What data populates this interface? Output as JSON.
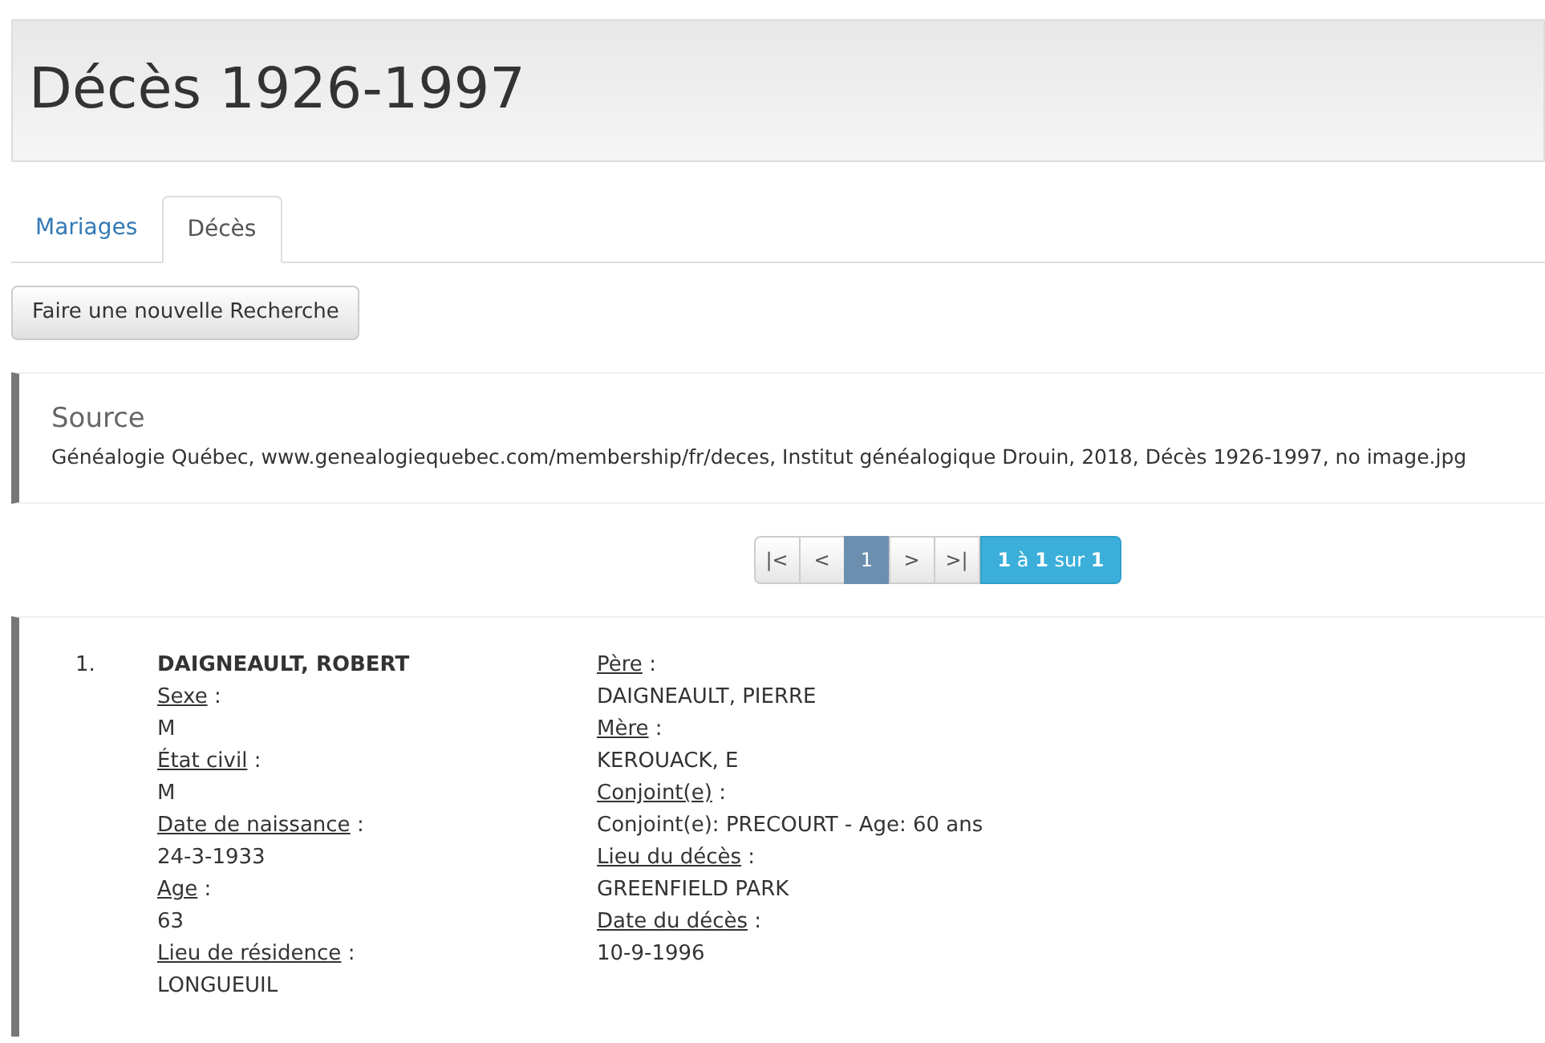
{
  "page_title": "Décès 1926-1997",
  "tabs": [
    {
      "label": "Mariages",
      "selected": false
    },
    {
      "label": "Décès",
      "selected": true
    }
  ],
  "new_search_button": "Faire une nouvelle Recherche",
  "source": {
    "heading": "Source",
    "text": "Généalogie Québec, www.genealogiequebec.com/membership/fr/deces, Institut généalogique Drouin, 2018, Décès 1926-1997, no image.jpg"
  },
  "pagination": {
    "pages": [
      {
        "label": "|<",
        "selected": false
      },
      {
        "label": "<",
        "selected": false
      },
      {
        "label": "1",
        "selected": true
      },
      {
        "label": ">",
        "selected": false
      },
      {
        "label": ">|",
        "selected": false
      }
    ],
    "summary": "**1** à **1** sur **1**"
  },
  "results": [
    {
      "number": "1.",
      "name": "DAIGNEAULT, ROBERT",
      "left_fields": [
        {
          "label": "Sexe",
          "sep": ":",
          "value": "M"
        },
        {
          "label": "État civil",
          "sep": ":",
          "value": "M"
        },
        {
          "label": "Date de naissance",
          "sep": ":",
          "value": "24-3-1933"
        },
        {
          "label": "Age",
          "sep": ":",
          "value": "63"
        },
        {
          "label": "Lieu de résidence",
          "sep": ":",
          "value": "LONGUEUIL"
        }
      ],
      "right_fields": [
        {
          "label": "Père",
          "sep": ":",
          "value": "DAIGNEAULT, PIERRE"
        },
        {
          "label": "Mère",
          "sep": ":",
          "value": "KEROUACK, E"
        },
        {
          "label": "Conjoint(e)",
          "sep": ":",
          "value": "Conjoint(e): PRECOURT - Age: 60 ans"
        },
        {
          "label": "Lieu du décès",
          "sep": ":",
          "value": "GREENFIELD PARK"
        },
        {
          "label": "Date du décès",
          "sep": ":",
          "value": "10-9-1996"
        }
      ]
    }
  ]
}
